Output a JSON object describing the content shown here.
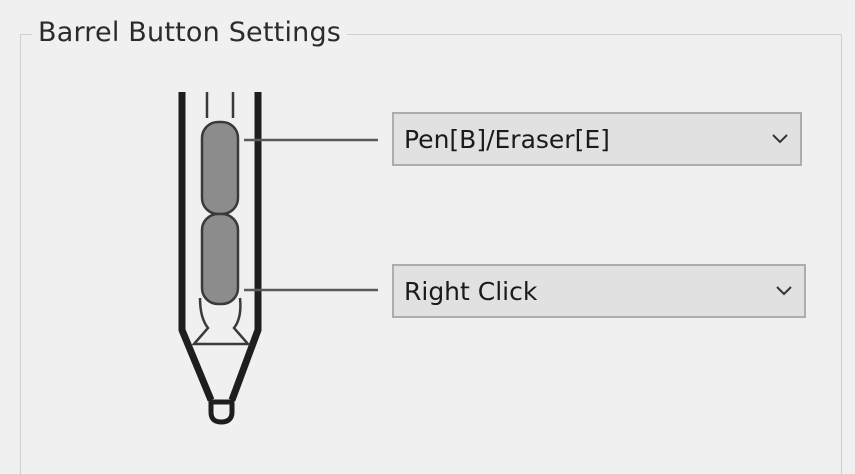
{
  "group": {
    "title": "Barrel Button Settings"
  },
  "upper_button": {
    "selected": "Pen[B]/Eraser[E]",
    "icon": "chevron-down-icon"
  },
  "lower_button": {
    "selected": "Right Click",
    "icon": "chevron-down-icon"
  },
  "illustration": {
    "icon": "pen-icon",
    "buttons_color": "#8c8c8c"
  }
}
